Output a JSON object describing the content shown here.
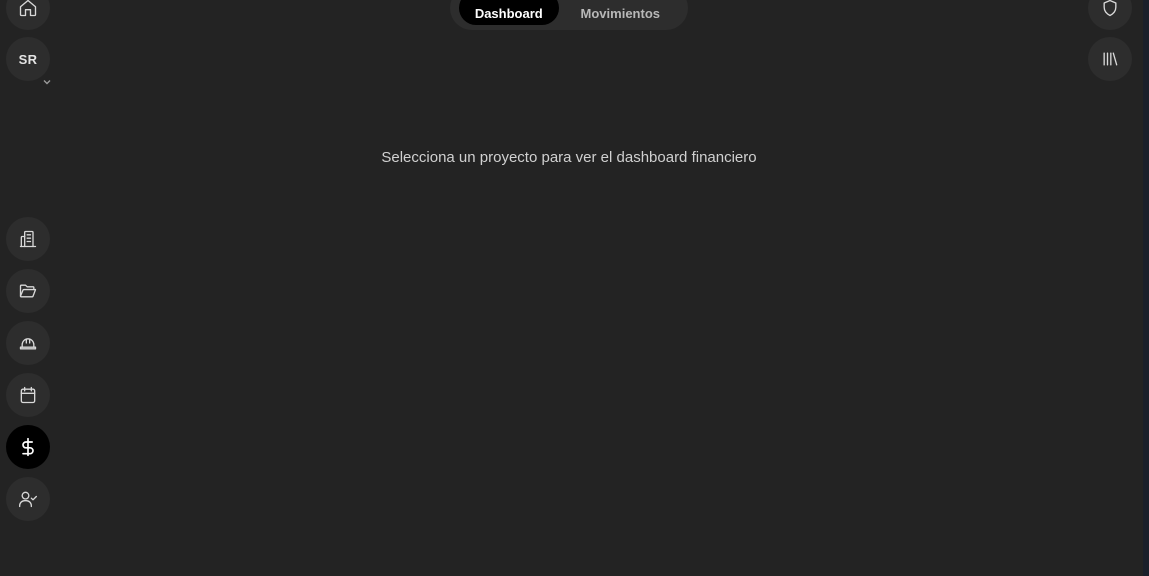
{
  "header": {
    "tabs": [
      {
        "label": "Dashboard",
        "active": true
      },
      {
        "label": "Movimientos",
        "active": false
      }
    ]
  },
  "user": {
    "initials": "SR"
  },
  "sidebar": {
    "items": [
      {
        "icon": "building-icon"
      },
      {
        "icon": "folder-open-icon"
      },
      {
        "icon": "hard-hat-icon"
      },
      {
        "icon": "calendar-icon"
      },
      {
        "icon": "dollar-icon",
        "active": true
      },
      {
        "icon": "user-check-icon"
      }
    ]
  },
  "main": {
    "empty_message": "Selecciona un proyecto para ver el dashboard financiero"
  },
  "colors": {
    "background": "#232323",
    "button_bg": "#2d2d2d",
    "active_bg": "#000000"
  }
}
